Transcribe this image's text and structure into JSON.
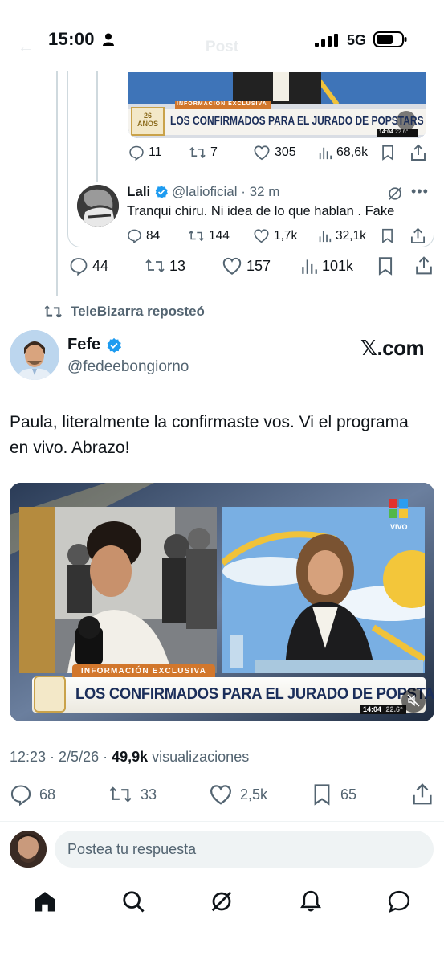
{
  "status_bar": {
    "time": "15:00",
    "network": "5G",
    "ghost_title": "Post"
  },
  "quoted": {
    "media_caption_top": "INFORMACIÓN EXCLUSIVA",
    "media_caption": "LOS CONFIRMADOS PARA EL JURADO DE POPSTARS",
    "media_time": "14:04",
    "media_temp": "22.6°",
    "media_badge": "26 AÑOS",
    "stats": {
      "replies": "11",
      "reposts": "7",
      "likes": "305",
      "views": "68,6k"
    },
    "reply": {
      "name": "Lali",
      "handle": "@lalioficial · 32 m",
      "text": "Tranqui chiru. Ni idea de lo que hablan . Fake",
      "stats": {
        "replies": "84",
        "reposts": "144",
        "likes": "1,7k",
        "views": "32,1k"
      }
    }
  },
  "thread_stats": {
    "replies": "44",
    "reposts": "13",
    "likes": "157",
    "views": "101k"
  },
  "repost_label": "TeleBizarra reposteó",
  "post": {
    "name": "Fefe",
    "handle": "@fedeebongiorno",
    "brand": "𝕏.com",
    "text": "Paula, literalmente la confirmaste vos. Vi el programa en vivo. Abrazo!",
    "video": {
      "caption_top": "INFORMACIÓN EXCLUSIVA",
      "caption": "LOS CONFIRMADOS PARA EL JURADO DE POPSTARS",
      "live": "VIVO",
      "time": "14:04",
      "temp": "22.6°"
    },
    "timestamp": "12:23 · 2/5/26 · ",
    "views_count": "49,9k",
    "views_label": " visualizaciones",
    "stats": {
      "replies": "68",
      "reposts": "33",
      "likes": "2,5k",
      "bookmarks": "65"
    }
  },
  "composer": {
    "placeholder": "Postea tu respuesta"
  },
  "tabs": [
    "home-icon",
    "search-icon",
    "grok-icon",
    "notifications-icon",
    "messages-icon"
  ],
  "colors": {
    "accent": "#1d9bf0",
    "muted": "#536471",
    "text": "#0f1419"
  }
}
